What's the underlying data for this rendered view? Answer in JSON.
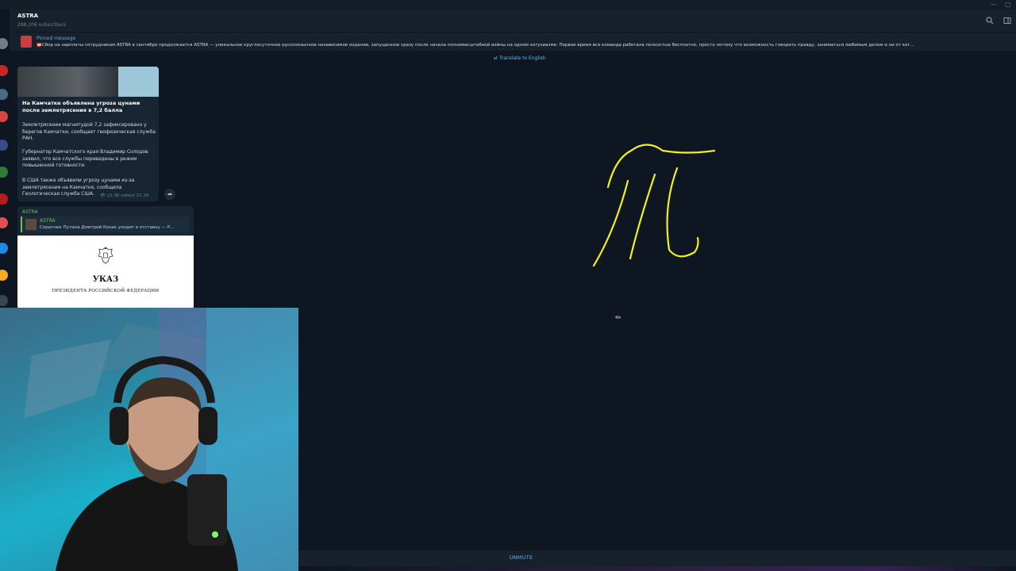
{
  "window": {
    "minimize_glyph": "—",
    "maximize_glyph": "▢"
  },
  "channel": {
    "title": "ASTRA",
    "subscribers": "288,206 subscribers"
  },
  "header_icons": [
    "search-icon",
    "sidebar-toggle-icon"
  ],
  "pinned": {
    "label": "Pinned message",
    "text": "📛Сбор на зарплаты сотрудникам ASTRA в сентябре продолжается   ASTRA — уникальное круглосуточное русскоязычное независимое издание, запущенное сразу после начала полномасштабной войны на одном энтузиазме. Первое время вся команда работала полностью бесплатно, просто потому что возможность говорить правду, заниматься любимым делом и ни от ког..."
  },
  "translate_label": "Translate to English",
  "post1": {
    "title": "На Камчатке объявлена угроза цунами после землетрясения в 7,2 балла",
    "paragraphs": [
      "Землетрясение магнитудой 7,2 зафиксировано у берегов Камчатки, сообщает геофизическая служба РАН.",
      "Губернатор Камчатского края Владимир Солодов заявил, что все службы переведены в режим повышенной готовности.",
      "В США также объявили угрозу цунами из-за землетрясения на Камчатке, сообщила Геологическая служба США."
    ],
    "views": "👁 22.3K",
    "edited": "edited 21:28"
  },
  "post2": {
    "author": "ASTRA",
    "reply_author": "ASTRA",
    "reply_text": "Соратник Путина Дмитрий Козак уходит в отставку — Р...",
    "doc_title": "УКАЗ",
    "doc_subtitle": "ПРЕЗИДЕНТА РОССИЙСКОЙ ФЕДЕРАЦИИ"
  },
  "drawing_color": "#f5f01a",
  "bottom": {
    "unmute_label": "UNMUTE"
  },
  "colors": {
    "accent": "#6ab3f3",
    "background": "#0e1621",
    "panel": "#17212b",
    "author_green": "#70c05a"
  }
}
